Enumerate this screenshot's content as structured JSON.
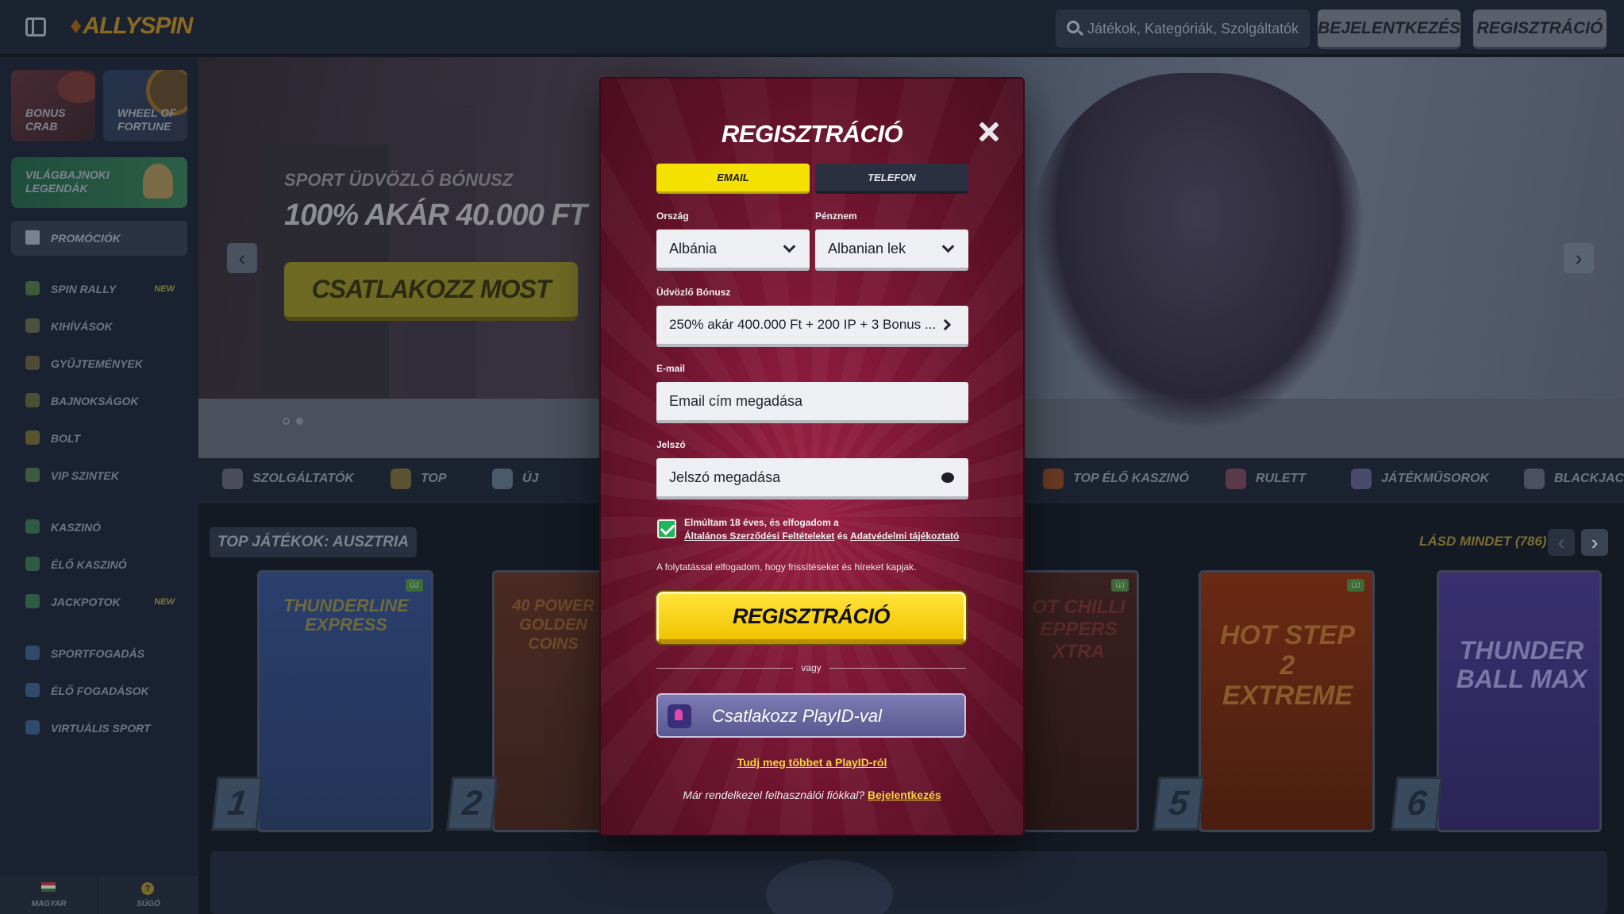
{
  "header": {
    "logo": "ALLYSPIN",
    "search_placeholder": "Játékok, Kategóriák, Szolgáltatók",
    "login_label": "BEJELENTKEZÉS",
    "register_label": "REGISZTRÁCIÓ"
  },
  "sidebar": {
    "tiles": {
      "bonus_crab": "BONUS CRAB",
      "wheel": "WHEEL OF FORTUNE",
      "legends": "VILÁGBAJNOKI LEGENDÁK"
    },
    "promo_label": "PROMÓCIÓK",
    "items": [
      {
        "label": "SPIN RALLY",
        "badge": "NEW",
        "icon": "rally-flag-icon"
      },
      {
        "label": "KIHÍVÁSOK",
        "badge": "",
        "icon": "medal-icon"
      },
      {
        "label": "GYŰJTEMÉNYEK",
        "badge": "",
        "icon": "collection-icon"
      },
      {
        "label": "BAJNOKSÁGOK",
        "badge": "",
        "icon": "trophy-icon"
      },
      {
        "label": "BOLT",
        "badge": "",
        "icon": "cart-icon"
      },
      {
        "label": "VIP SZINTEK",
        "badge": "",
        "icon": "diamond-icon"
      },
      {
        "label": "KASZINÓ",
        "badge": "",
        "icon": "slot-icon"
      },
      {
        "label": "ÉLŐ KASZINÓ",
        "badge": "",
        "icon": "live-icon"
      },
      {
        "label": "JACKPOTOK",
        "badge": "NEW",
        "icon": "jackpot-icon"
      },
      {
        "label": "SPORTFOGADÁS",
        "badge": "",
        "icon": "ball-icon"
      },
      {
        "label": "ÉLŐ FOGADÁSOK",
        "badge": "",
        "icon": "live-bet-icon"
      },
      {
        "label": "VIRTUÁLIS SPORT",
        "badge": "",
        "icon": "virtual-icon"
      }
    ],
    "language_label": "MAGYAR",
    "help_label": "SÚGÓ"
  },
  "hero": {
    "kicker": "SPORT ÜDVÖZLŐ BÓNUSZ",
    "title": "100% AKÁR 40.000 FT",
    "cta": "CSATLAKOZZ MOST"
  },
  "categories": [
    {
      "label": "SZOLGÁLTATÓK"
    },
    {
      "label": "TOP"
    },
    {
      "label": "ÚJ"
    },
    {
      "label": "TOP ÉLŐ KASZINÓ"
    },
    {
      "label": "RULETT"
    },
    {
      "label": "JÁTÉKMŰSOROK"
    },
    {
      "label": "BLACKJACK"
    }
  ],
  "games_section": {
    "title": "TOP JÁTÉKOK: AUSZTRIA",
    "see_all": "LÁSD MINDET (786)",
    "new_badge": "ÚJ",
    "cards": [
      {
        "rank": "1",
        "name": "THUNDERLINE EXPRESS",
        "color": "#2b4a86"
      },
      {
        "rank": "2",
        "name": "40 POWER GOLDEN COINS",
        "color": "#6b2f1d"
      },
      {
        "rank": "5",
        "name": "HOT STEP 2 EXTREME",
        "color": "#8a2a14"
      },
      {
        "rank": "6",
        "name": "THUNDER BALL MAX",
        "color": "#3a2f86"
      }
    ],
    "partial_card": "OT CHILLI EPPERS XTRA"
  },
  "modal": {
    "title": "REGISZTRÁCIÓ",
    "tab_email": "EMAIL",
    "tab_phone": "TELEFON",
    "country_label": "Ország",
    "country_value": "Albánia",
    "currency_label": "Pénznem",
    "currency_value": "Albanian lek",
    "bonus_label": "Üdvözlő Bónusz",
    "bonus_value": "250% akár 400.000 Ft + 200 IP + 3 Bonus ...",
    "email_label": "E-mail",
    "email_placeholder": "Email cím megadása",
    "password_label": "Jelszó",
    "password_placeholder": "Jelszó megadása",
    "terms_prefix": "Elmúltam 18 éves, és elfogadom a",
    "terms_link": "Általános Szerződési Feltételeket",
    "terms_and": "és",
    "privacy_link": "Adatvédelmi tájékoztató",
    "info": "A folytatással elfogadom, hogy frissítéseket és híreket kapjak.",
    "submit": "REGISZTRÁCIÓ",
    "or": "vagy",
    "playid": "Csatlakozz PlayID-val",
    "learn_more": "Tudj meg többet a PlayID-ról",
    "have_account": "Már rendelkezel felhasználói fiókkal?",
    "login_link": "Bejelentkezés"
  },
  "colors": {
    "accent": "#f4e100",
    "modal_bg": "#7d1736",
    "checkbox": "#20b55a"
  }
}
